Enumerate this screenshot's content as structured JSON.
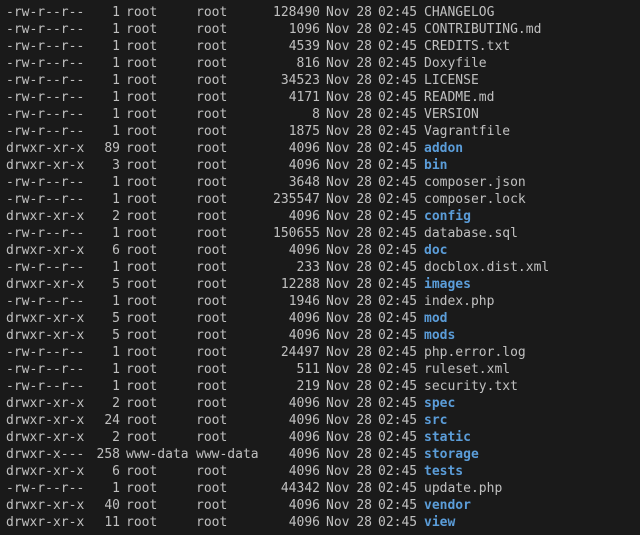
{
  "listing": [
    {
      "perms": "-rw-r--r--",
      "links": 1,
      "owner": "root",
      "group": "root",
      "size": 128490,
      "month": "Nov",
      "day": 28,
      "time": "02:45",
      "name": "CHANGELOG",
      "type": "file"
    },
    {
      "perms": "-rw-r--r--",
      "links": 1,
      "owner": "root",
      "group": "root",
      "size": 1096,
      "month": "Nov",
      "day": 28,
      "time": "02:45",
      "name": "CONTRIBUTING.md",
      "type": "file"
    },
    {
      "perms": "-rw-r--r--",
      "links": 1,
      "owner": "root",
      "group": "root",
      "size": 4539,
      "month": "Nov",
      "day": 28,
      "time": "02:45",
      "name": "CREDITS.txt",
      "type": "file"
    },
    {
      "perms": "-rw-r--r--",
      "links": 1,
      "owner": "root",
      "group": "root",
      "size": 816,
      "month": "Nov",
      "day": 28,
      "time": "02:45",
      "name": "Doxyfile",
      "type": "file"
    },
    {
      "perms": "-rw-r--r--",
      "links": 1,
      "owner": "root",
      "group": "root",
      "size": 34523,
      "month": "Nov",
      "day": 28,
      "time": "02:45",
      "name": "LICENSE",
      "type": "file"
    },
    {
      "perms": "-rw-r--r--",
      "links": 1,
      "owner": "root",
      "group": "root",
      "size": 4171,
      "month": "Nov",
      "day": 28,
      "time": "02:45",
      "name": "README.md",
      "type": "file"
    },
    {
      "perms": "-rw-r--r--",
      "links": 1,
      "owner": "root",
      "group": "root",
      "size": 8,
      "month": "Nov",
      "day": 28,
      "time": "02:45",
      "name": "VERSION",
      "type": "file"
    },
    {
      "perms": "-rw-r--r--",
      "links": 1,
      "owner": "root",
      "group": "root",
      "size": 1875,
      "month": "Nov",
      "day": 28,
      "time": "02:45",
      "name": "Vagrantfile",
      "type": "file"
    },
    {
      "perms": "drwxr-xr-x",
      "links": 89,
      "owner": "root",
      "group": "root",
      "size": 4096,
      "month": "Nov",
      "day": 28,
      "time": "02:45",
      "name": "addon",
      "type": "dir"
    },
    {
      "perms": "drwxr-xr-x",
      "links": 3,
      "owner": "root",
      "group": "root",
      "size": 4096,
      "month": "Nov",
      "day": 28,
      "time": "02:45",
      "name": "bin",
      "type": "dir"
    },
    {
      "perms": "-rw-r--r--",
      "links": 1,
      "owner": "root",
      "group": "root",
      "size": 3648,
      "month": "Nov",
      "day": 28,
      "time": "02:45",
      "name": "composer.json",
      "type": "file"
    },
    {
      "perms": "-rw-r--r--",
      "links": 1,
      "owner": "root",
      "group": "root",
      "size": 235547,
      "month": "Nov",
      "day": 28,
      "time": "02:45",
      "name": "composer.lock",
      "type": "file"
    },
    {
      "perms": "drwxr-xr-x",
      "links": 2,
      "owner": "root",
      "group": "root",
      "size": 4096,
      "month": "Nov",
      "day": 28,
      "time": "02:45",
      "name": "config",
      "type": "dir"
    },
    {
      "perms": "-rw-r--r--",
      "links": 1,
      "owner": "root",
      "group": "root",
      "size": 150655,
      "month": "Nov",
      "day": 28,
      "time": "02:45",
      "name": "database.sql",
      "type": "file"
    },
    {
      "perms": "drwxr-xr-x",
      "links": 6,
      "owner": "root",
      "group": "root",
      "size": 4096,
      "month": "Nov",
      "day": 28,
      "time": "02:45",
      "name": "doc",
      "type": "dir"
    },
    {
      "perms": "-rw-r--r--",
      "links": 1,
      "owner": "root",
      "group": "root",
      "size": 233,
      "month": "Nov",
      "day": 28,
      "time": "02:45",
      "name": "docblox.dist.xml",
      "type": "file"
    },
    {
      "perms": "drwxr-xr-x",
      "links": 5,
      "owner": "root",
      "group": "root",
      "size": 12288,
      "month": "Nov",
      "day": 28,
      "time": "02:45",
      "name": "images",
      "type": "dir"
    },
    {
      "perms": "-rw-r--r--",
      "links": 1,
      "owner": "root",
      "group": "root",
      "size": 1946,
      "month": "Nov",
      "day": 28,
      "time": "02:45",
      "name": "index.php",
      "type": "file"
    },
    {
      "perms": "drwxr-xr-x",
      "links": 5,
      "owner": "root",
      "group": "root",
      "size": 4096,
      "month": "Nov",
      "day": 28,
      "time": "02:45",
      "name": "mod",
      "type": "dir"
    },
    {
      "perms": "drwxr-xr-x",
      "links": 5,
      "owner": "root",
      "group": "root",
      "size": 4096,
      "month": "Nov",
      "day": 28,
      "time": "02:45",
      "name": "mods",
      "type": "dir"
    },
    {
      "perms": "-rw-r--r--",
      "links": 1,
      "owner": "root",
      "group": "root",
      "size": 24497,
      "month": "Nov",
      "day": 28,
      "time": "02:45",
      "name": "php.error.log",
      "type": "file"
    },
    {
      "perms": "-rw-r--r--",
      "links": 1,
      "owner": "root",
      "group": "root",
      "size": 511,
      "month": "Nov",
      "day": 28,
      "time": "02:45",
      "name": "ruleset.xml",
      "type": "file"
    },
    {
      "perms": "-rw-r--r--",
      "links": 1,
      "owner": "root",
      "group": "root",
      "size": 219,
      "month": "Nov",
      "day": 28,
      "time": "02:45",
      "name": "security.txt",
      "type": "file"
    },
    {
      "perms": "drwxr-xr-x",
      "links": 2,
      "owner": "root",
      "group": "root",
      "size": 4096,
      "month": "Nov",
      "day": 28,
      "time": "02:45",
      "name": "spec",
      "type": "dir"
    },
    {
      "perms": "drwxr-xr-x",
      "links": 24,
      "owner": "root",
      "group": "root",
      "size": 4096,
      "month": "Nov",
      "day": 28,
      "time": "02:45",
      "name": "src",
      "type": "dir"
    },
    {
      "perms": "drwxr-xr-x",
      "links": 2,
      "owner": "root",
      "group": "root",
      "size": 4096,
      "month": "Nov",
      "day": 28,
      "time": "02:45",
      "name": "static",
      "type": "dir"
    },
    {
      "perms": "drwxr-x---",
      "links": 258,
      "owner": "www-data",
      "group": "www-data",
      "size": 4096,
      "month": "Nov",
      "day": 28,
      "time": "02:45",
      "name": "storage",
      "type": "dir"
    },
    {
      "perms": "drwxr-xr-x",
      "links": 6,
      "owner": "root",
      "group": "root",
      "size": 4096,
      "month": "Nov",
      "day": 28,
      "time": "02:45",
      "name": "tests",
      "type": "dir"
    },
    {
      "perms": "-rw-r--r--",
      "links": 1,
      "owner": "root",
      "group": "root",
      "size": 44342,
      "month": "Nov",
      "day": 28,
      "time": "02:45",
      "name": "update.php",
      "type": "file"
    },
    {
      "perms": "drwxr-xr-x",
      "links": 40,
      "owner": "root",
      "group": "root",
      "size": 4096,
      "month": "Nov",
      "day": 28,
      "time": "02:45",
      "name": "vendor",
      "type": "dir"
    },
    {
      "perms": "drwxr-xr-x",
      "links": 11,
      "owner": "root",
      "group": "root",
      "size": 4096,
      "month": "Nov",
      "day": 28,
      "time": "02:45",
      "name": "view",
      "type": "dir"
    }
  ]
}
